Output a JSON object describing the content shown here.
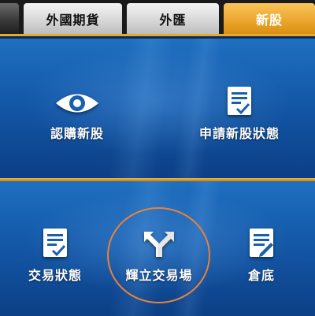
{
  "tabs": [
    {
      "label": "外國期貨"
    },
    {
      "label": "外匯"
    },
    {
      "label": "新股"
    }
  ],
  "top_menu": [
    {
      "label": "認購新股",
      "icon": "eye-icon"
    },
    {
      "label": "申請新股狀態",
      "icon": "document-check-icon"
    }
  ],
  "bottom_menu": [
    {
      "label": "交易狀態",
      "icon": "document-check-icon"
    },
    {
      "label": "輝立交易場",
      "icon": "crossing-arrows-icon"
    },
    {
      "label": "倉底",
      "icon": "document-pen-icon"
    }
  ],
  "colors": {
    "accent": "#e8a92a",
    "highlight_circle": "#e8823a",
    "panel_blue": "#1458a8"
  }
}
